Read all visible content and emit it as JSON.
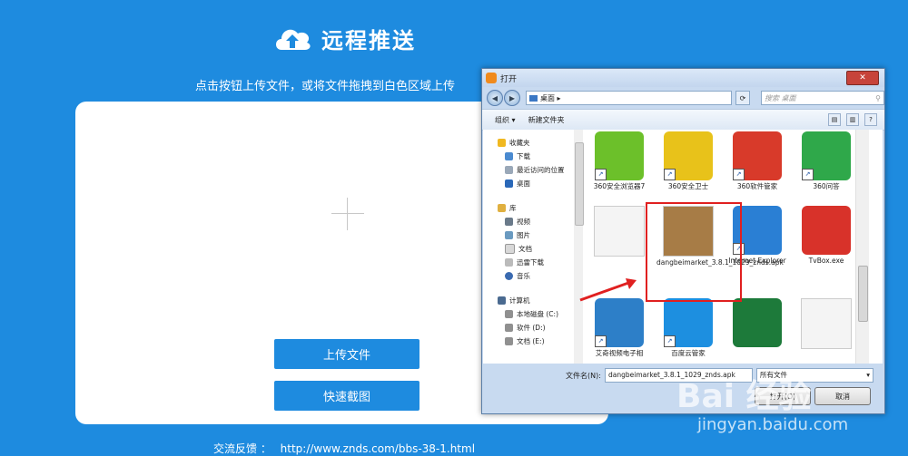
{
  "header": {
    "title": "远程推送",
    "icon": "cloud-upload-icon"
  },
  "instructions": "点击按钮上传文件，或将文件拖拽到白色区域上传",
  "buttons": {
    "upload": "上传文件",
    "screenshot": "快速截图"
  },
  "feedback": {
    "label": "交流反馈 ：",
    "url": "http://www.znds.com/bbs-38-1.html"
  },
  "dialog": {
    "title": "打开",
    "close": "✕",
    "address": "桌面 ▸",
    "search_placeholder": "搜索 桌面",
    "toolbar": {
      "organize": "组织 ▾",
      "new_folder": "新建文件夹"
    },
    "nav": {
      "favorites": "收藏夹",
      "downloads": "下载",
      "recent": "最近访问的位置",
      "desktop": "桌面",
      "libraries": "库",
      "videos": "视频",
      "pictures": "图片",
      "documents": "文档",
      "xunlei": "迅雷下载",
      "music": "音乐",
      "computer": "计算机",
      "disk_c": "本地磁盘 (C:)",
      "disk_d": "软件 (D:)",
      "disk_e": "文档 (E:)"
    },
    "files": [
      {
        "label": "360安全浏览器7",
        "color": "#6cc02a"
      },
      {
        "label": "360安全卫士",
        "color": "#e8c21a"
      },
      {
        "label": "360软件管家",
        "color": "#d83a2a"
      },
      {
        "label": "360问答",
        "color": "#2fa84a"
      },
      {
        "label": "",
        "color": "#f4f4f4"
      },
      {
        "label": "dangbeimarket_3.8.1_1029_znds.apk",
        "color": "#a77c46"
      },
      {
        "label": "Internet Explorer",
        "color": "#2a7fd4"
      },
      {
        "label": "TvBox.exe",
        "color": "#d8322a"
      },
      {
        "label": "艾奇视频电子相",
        "color": "#2d7fc8"
      },
      {
        "label": "百度云管家",
        "color": "#1d8fe0"
      },
      {
        "label": "",
        "color": "#1d7a3a"
      },
      {
        "label": "",
        "color": "#f4f4f4"
      }
    ],
    "filename_label": "文件名(N):",
    "filename_value": "dangbeimarket_3.8.1_1029_znds.apk",
    "filetype_value": "所有文件",
    "open_button": "打开(O)",
    "cancel_button": "取消"
  },
  "watermark": {
    "logo": "Bai 经验",
    "url": "jingyan.baidu.com"
  },
  "colors": {
    "background": "#1e8bdf",
    "accent": "#1e8bdf",
    "highlight": "#e02020"
  }
}
